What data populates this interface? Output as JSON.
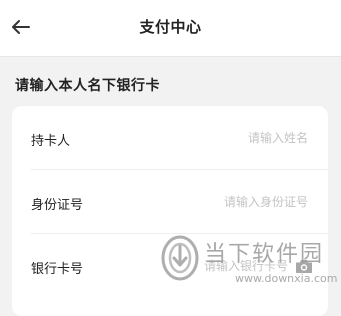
{
  "header": {
    "title": "支付中心",
    "back_icon": "arrow-left-icon"
  },
  "section": {
    "title": "请输入本人名下银行卡"
  },
  "form": {
    "rows": [
      {
        "label": "持卡人",
        "placeholder": "请输入姓名"
      },
      {
        "label": "身份证号",
        "placeholder": "请输入身份证号"
      },
      {
        "label": "银行卡号",
        "placeholder": "请输入银行卡号",
        "icon": "camera-icon"
      }
    ]
  },
  "watermark": {
    "text": "当下软件园",
    "url": "www.downxia.com",
    "icon": "downxia-logo"
  },
  "colors": {
    "background": "#f2f2f2",
    "card": "#ffffff",
    "placeholder": "#c4c4c4"
  }
}
